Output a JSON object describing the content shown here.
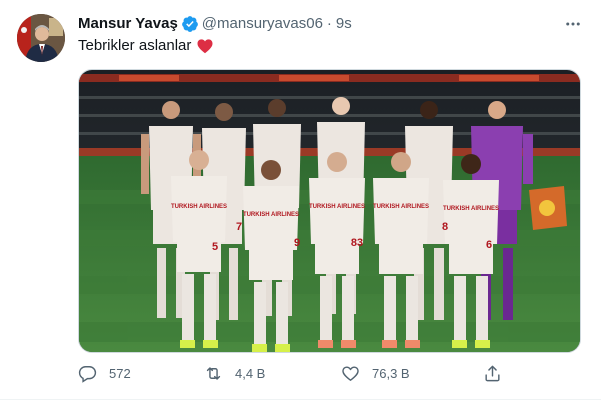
{
  "author": {
    "display_name": "Mansur Yavaş",
    "handle": "@mansuryavas06",
    "separator": "·",
    "time": "9s",
    "verified": true
  },
  "tweet": {
    "text": "Tebrikler aslanlar",
    "emoji": "red-heart-icon"
  },
  "media": {
    "kit_sponsor": "TURKISH AIRLINES",
    "shirt_numbers": [
      "5",
      "7",
      "8",
      "9",
      "83",
      "6"
    ]
  },
  "actions": {
    "reply_count": "572",
    "retweet_count": "4,4 B",
    "like_count": "76,3 B"
  },
  "colors": {
    "verified": "#1d9bf0",
    "heart": "#e0245e",
    "muted": "#536471",
    "kit": "#ece6e0",
    "pitch": "#3e7a3a"
  }
}
